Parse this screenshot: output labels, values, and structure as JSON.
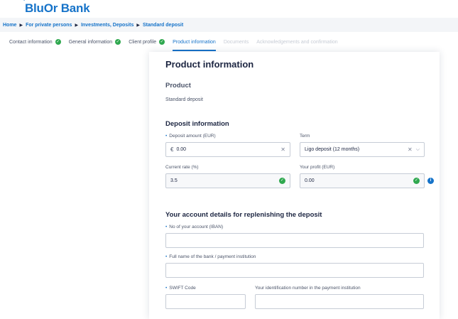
{
  "brand": {
    "logo_mark": "'",
    "logo_text": "BluOr Bank"
  },
  "breadcrumb": [
    "Home",
    "For private persons",
    "Investments, Deposits",
    "Standard deposit"
  ],
  "steps": [
    {
      "label": "Contact information",
      "state": "done"
    },
    {
      "label": "General information",
      "state": "done"
    },
    {
      "label": "Client profile",
      "state": "done"
    },
    {
      "label": "Product information",
      "state": "active"
    },
    {
      "label": "Documents",
      "state": "disabled"
    },
    {
      "label": "Acknowledgements and confirmation",
      "state": "disabled"
    }
  ],
  "form": {
    "title": "Product information",
    "product": {
      "heading": "Product",
      "value": "Standard deposit"
    },
    "deposit": {
      "heading": "Deposit information",
      "amount_label": "Deposit amount (EUR)",
      "currency_symbol": "€",
      "amount_value": "0.00",
      "term_label": "Term",
      "term_value": "Ligo deposit (12 months)",
      "rate_label": "Current rate (%)",
      "rate_value": "3.5",
      "profit_label": "Your profit (EUR)",
      "profit_value": "0.00"
    },
    "account": {
      "heading": "Your account details for replenishing the deposit",
      "iban_label": "No of your account (IBAN)",
      "bank_label": "Full name of the bank / payment institution",
      "swift_label": "SWIFT Code",
      "idnum_label": "Your identification number in the payment institution"
    }
  },
  "colors": {
    "accent": "#1673c9",
    "success": "#2fa84f",
    "text": "#1c2541"
  }
}
